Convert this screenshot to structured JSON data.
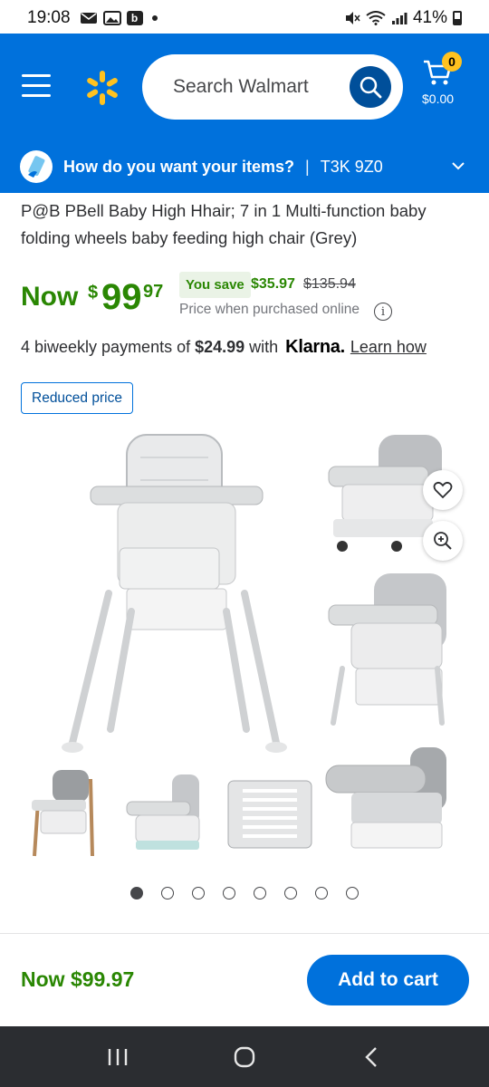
{
  "status_bar": {
    "time": "19:08",
    "battery": "41%",
    "b_icon": "b"
  },
  "header": {
    "search_placeholder": "Search Walmart",
    "cart_count": "0",
    "cart_total": "$0.00",
    "brand_color": "#0071dc",
    "spark_color": "#ffc220"
  },
  "delivery": {
    "question": "How do you want your items?",
    "separator": "|",
    "postal_code": "T3K 9Z0"
  },
  "product": {
    "title": "P@B PBell Baby High Hhair; 7 in 1 Multi-function baby folding wheels baby feeding high chair (Grey)",
    "now_label": "Now",
    "price_dollar_sign": "$",
    "price_whole": "99",
    "price_cents": "97",
    "you_save_label": "You save",
    "save_amount": "$35.97",
    "was_price": "$135.94",
    "online_note": "Price when purchased online",
    "info_icon": "i",
    "price_color": "#2a8703"
  },
  "klarna": {
    "prefix": "4 biweekly payments of",
    "amount": "$24.99",
    "with": "with",
    "logo": "Klarna.",
    "learn_how": "Learn how"
  },
  "badge": {
    "reduced": "Reduced price"
  },
  "gallery": {
    "dot_count": 8,
    "active_dot": 0
  },
  "footer": {
    "now_price": "Now $99.97",
    "add_to_cart": "Add to cart"
  }
}
